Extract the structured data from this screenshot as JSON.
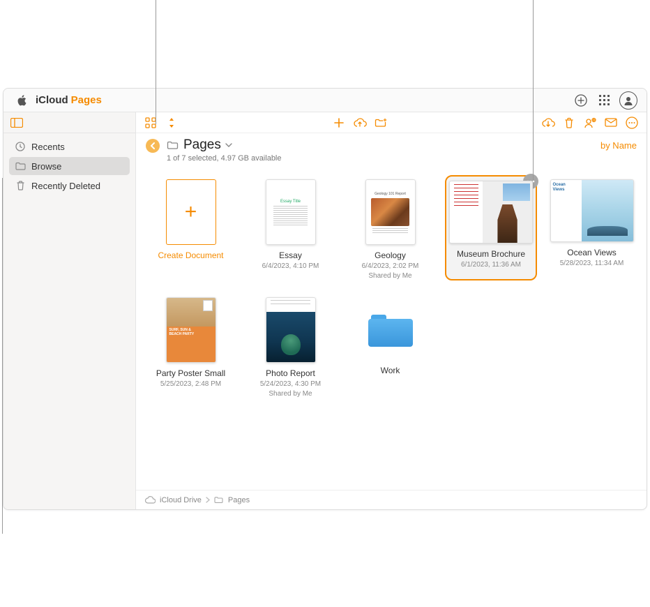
{
  "brand": {
    "icloud": "iCloud",
    "pages": "Pages"
  },
  "sidebar": {
    "items": [
      {
        "label": "Recents"
      },
      {
        "label": "Browse"
      },
      {
        "label": "Recently Deleted"
      }
    ]
  },
  "header": {
    "title": "Pages",
    "status": "1 of 7 selected, 4.97 GB available",
    "sort": "by Name"
  },
  "grid": {
    "create_label": "Create Document",
    "items": [
      {
        "name": "Essay",
        "meta1": "6/4/2023, 4:10 PM"
      },
      {
        "name": "Geology",
        "meta1": "6/4/2023, 2:02 PM",
        "meta2": "Shared by Me"
      },
      {
        "name": "Museum Brochure",
        "meta1": "6/1/2023, 11:36 AM"
      },
      {
        "name": "Ocean Views",
        "meta1": "5/28/2023, 11:34 AM"
      },
      {
        "name": "Party Poster Small",
        "meta1": "5/25/2023, 2:48 PM"
      },
      {
        "name": "Photo Report",
        "meta1": "5/24/2023, 4:30 PM",
        "meta2": "Shared by Me"
      },
      {
        "name": "Work"
      }
    ]
  },
  "ocean_title": "Ocean\nViews",
  "party_text": "SURF, SUN &\nBEACH PARTY",
  "breadcrumb": {
    "root": "iCloud Drive",
    "leaf": "Pages"
  }
}
